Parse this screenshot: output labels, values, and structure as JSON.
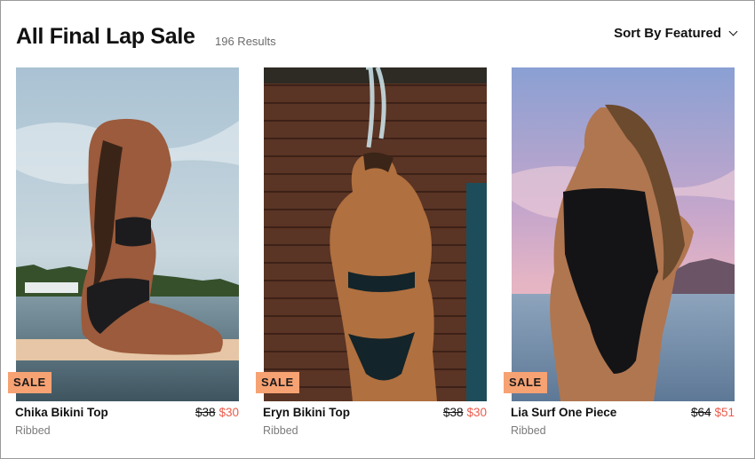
{
  "header": {
    "title": "All Final Lap Sale",
    "results": "196 Results",
    "sort_label": "Sort By Featured"
  },
  "products": [
    {
      "name": "Chika Bikini Top",
      "variant": "Ribbed",
      "badge": "SALE",
      "old_price": "$38",
      "price": "$30",
      "image": "woman in black bikini sitting on surfboard in water"
    },
    {
      "name": "Eryn Bikini Top",
      "variant": "Ribbed",
      "badge": "SALE",
      "old_price": "$38",
      "price": "$30",
      "image": "woman in black bikini under outdoor shower against wooden wall"
    },
    {
      "name": "Lia Surf One Piece",
      "variant": "Ribbed",
      "badge": "SALE",
      "old_price": "$64",
      "price": "$51",
      "image": "woman in black one piece swimsuit at sunset by the sea"
    }
  ],
  "colors": {
    "badge": "#f7a273",
    "sale_price": "#ea5b4b",
    "muted": "#7b7b7b"
  }
}
